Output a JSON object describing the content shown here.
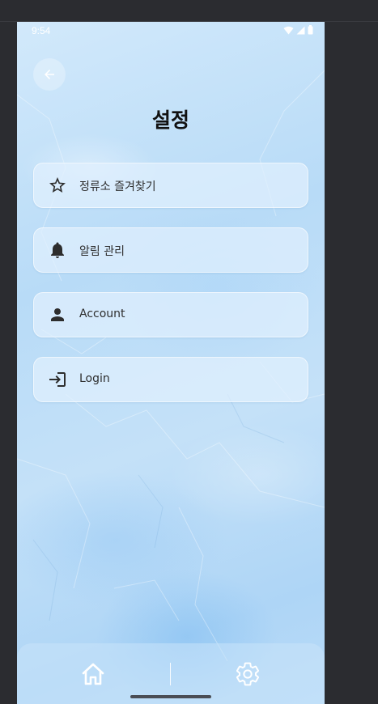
{
  "status_bar": {
    "time": "9:54"
  },
  "header": {
    "title": "설정"
  },
  "menu": {
    "items": [
      {
        "label": "정류소 즐겨찾기",
        "icon": "star-outline-icon"
      },
      {
        "label": "알림 관리",
        "icon": "bell-icon"
      },
      {
        "label": "Account",
        "icon": "person-icon"
      },
      {
        "label": "Login",
        "icon": "login-icon"
      }
    ]
  },
  "bottom_nav": {
    "items": [
      {
        "icon": "home-icon"
      },
      {
        "icon": "gear-icon"
      }
    ]
  },
  "colors": {
    "background_light": "#d2e9fb",
    "background_mid": "#b8dbf7",
    "card": "#e1f0fd",
    "icon_dark": "#2d2d2d",
    "nav_icon": "#ffffff",
    "emulator_frame": "#2b2c30"
  }
}
